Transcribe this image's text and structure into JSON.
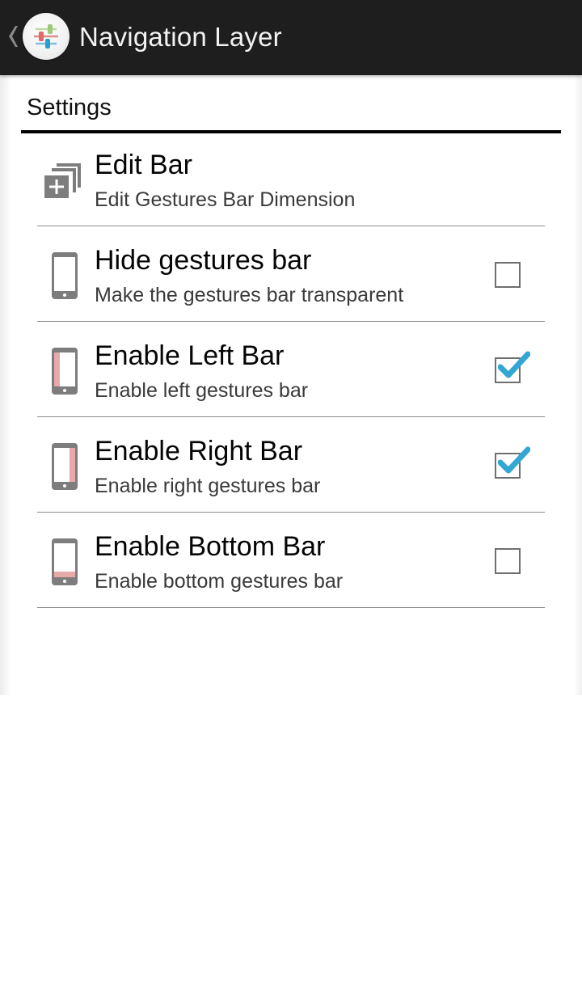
{
  "action_bar": {
    "title": "Navigation Layer",
    "up_icon": "chevron-left-icon",
    "app_icon": "sliders-icon"
  },
  "section": {
    "title": "Settings"
  },
  "preferences": [
    {
      "title": "Edit Bar",
      "summary": "Edit Gestures Bar Dimension",
      "icon": "add-layers-icon",
      "has_checkbox": false
    },
    {
      "title": "Hide gestures bar",
      "summary": "Make the gestures bar transparent",
      "icon": "phone-icon",
      "has_checkbox": true,
      "checked": false
    },
    {
      "title": "Enable Left Bar",
      "summary": "Enable left gestures bar",
      "icon": "phone-left-bar-icon",
      "has_checkbox": true,
      "checked": true
    },
    {
      "title": "Enable Right Bar",
      "summary": "Enable right gestures bar",
      "icon": "phone-right-bar-icon",
      "has_checkbox": true,
      "checked": true
    },
    {
      "title": "Enable Bottom Bar",
      "summary": "Enable bottom gestures bar",
      "icon": "phone-bottom-bar-icon",
      "has_checkbox": true,
      "checked": false
    }
  ],
  "colors": {
    "action_bar_bg": "#1e1e1e",
    "check_accent": "#33a6d4",
    "bar_highlight": "#e8a9a9",
    "icon_gray": "#7d7d7d"
  }
}
